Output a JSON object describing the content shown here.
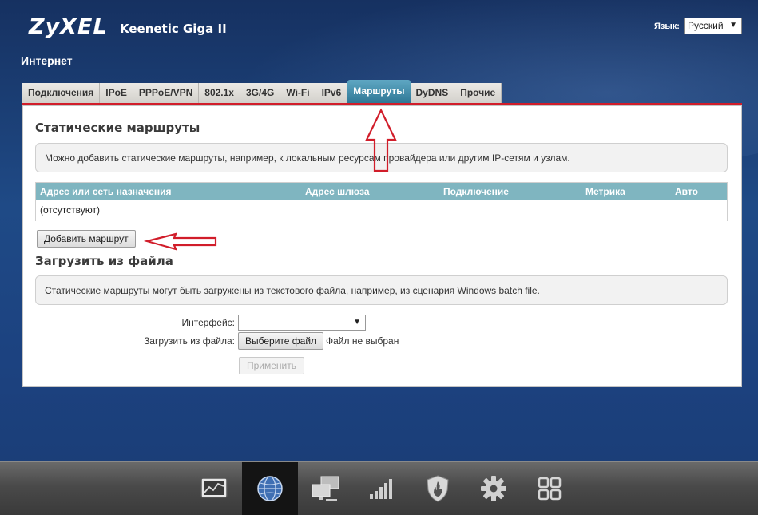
{
  "header": {
    "logo": "ZyXEL",
    "model": "Keenetic Giga II",
    "language_label": "Язык:",
    "language_value": "Русский"
  },
  "section_title": "Интернет",
  "tabs": [
    {
      "label": "Подключения",
      "active": false
    },
    {
      "label": "IPoE",
      "active": false
    },
    {
      "label": "PPPoE/VPN",
      "active": false
    },
    {
      "label": "802.1x",
      "active": false
    },
    {
      "label": "3G/4G",
      "active": false
    },
    {
      "label": "Wi-Fi",
      "active": false
    },
    {
      "label": "IPv6",
      "active": false
    },
    {
      "label": "Маршруты",
      "active": true
    },
    {
      "label": "DyDNS",
      "active": false
    },
    {
      "label": "Прочие",
      "active": false
    }
  ],
  "static_routes": {
    "title": "Статические маршруты",
    "info": "Можно добавить статические маршруты, например, к локальным ресурсам провайдера или другим IP-сетям и узлам.",
    "columns": [
      "Адрес или сеть назначения",
      "Адрес шлюза",
      "Подключение",
      "Метрика",
      "Авто"
    ],
    "empty_row": "(отсутствуют)",
    "add_button": "Добавить маршрут"
  },
  "load_file": {
    "title": "Загрузить из файла",
    "info": "Статические маршруты могут быть загружены из текстового файла, например, из сценария Windows batch file.",
    "interface_label": "Интерфейс:",
    "interface_value": "",
    "file_label": "Загрузить из файла:",
    "choose_file_button": "Выберите файл",
    "file_status": "Файл не выбран",
    "apply_button": "Применить"
  },
  "dock": [
    {
      "icon": "monitor-chart-icon",
      "active": false
    },
    {
      "icon": "globe-icon",
      "active": true
    },
    {
      "icon": "network-computers-icon",
      "active": false
    },
    {
      "icon": "signal-bars-icon",
      "active": false
    },
    {
      "icon": "shield-icon",
      "active": false
    },
    {
      "icon": "gear-icon",
      "active": false
    },
    {
      "icon": "apps-grid-icon",
      "active": false
    }
  ],
  "colors": {
    "accent_red": "#d11d2a",
    "active_tab": "#3d8aa8",
    "table_header": "#7fb5c0",
    "annotation_arrow": "#d11d2a"
  }
}
